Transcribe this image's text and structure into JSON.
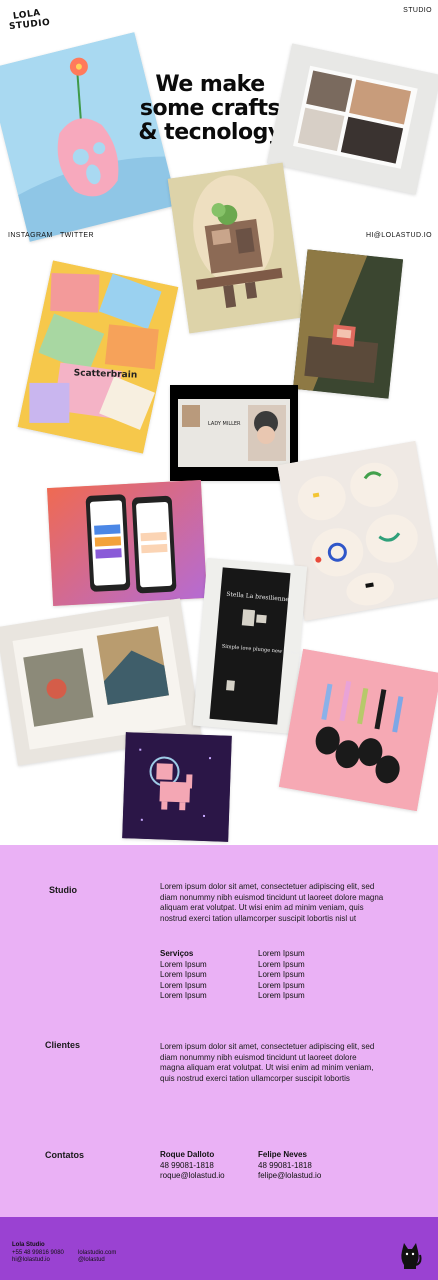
{
  "brand": {
    "logo_line1": "LOLA",
    "logo_line2": "STUDIO"
  },
  "nav": {
    "studio": "STUDIO"
  },
  "hero": {
    "title_line1": "We make",
    "title_line2": "some crafts",
    "title_line3": "& tecnology"
  },
  "social": {
    "instagram": "INSTAGRAM",
    "twitter": "TWITTER",
    "email": "HI@LOLASTUD.IO"
  },
  "cards": {
    "scatterbrain": "Scatterbrain",
    "lady_title": "LADY MILLER",
    "poster_text_1": "Stella La bresilienne",
    "poster_text_2": "Simple love plunge new release"
  },
  "info": {
    "studio_label": "Studio",
    "studio_text": "Lorem ipsum dolor sit amet, consectetuer adipiscing elit, sed diam nonummy nibh euismod tincidunt ut laoreet dolore magna aliquam erat volutpat. Ut wisi enim ad minim veniam, quis nostrud exerci tation ullamcorper suscipit lobortis nisl ut",
    "servicos_label": "Serviços",
    "servicos_col1": [
      "Lorem Ipsum",
      "Lorem Ipsum",
      "Lorem Ipsum",
      "Lorem Ipsum"
    ],
    "servicos_col2": [
      "Lorem Ipsum",
      "Lorem Ipsum",
      "Lorem Ipsum",
      "Lorem Ipsum",
      "Lorem Ipsum"
    ],
    "clientes_label": "Clientes",
    "clientes_text": "Lorem ipsum dolor sit amet, consectetuer adipiscing elit, sed diam nonummy nibh euismod tincidunt ut laoreet dolore magna aliquam erat volutpat. Ut wisi enim ad minim veniam, quis nostrud exerci tation ullamcorper suscipit lobortis",
    "contatos_label": "Contatos",
    "contact1": {
      "name": "Roque Dalloto",
      "phone": "48 99081-1818",
      "email": "roque@lolastud.io"
    },
    "contact2": {
      "name": "Felipe Neves",
      "phone": "48 99081-1818",
      "email": "felipe@lolastud.io"
    }
  },
  "footer": {
    "name": "Lola Studio",
    "phone": "+55 48 99816 9080",
    "email": "hi@lolastud.io",
    "site": "lolastudio.com",
    "handle": "@lolastud"
  },
  "colors": {
    "info_bg": "#eab1f5",
    "footer_bg": "#9a42d2"
  }
}
